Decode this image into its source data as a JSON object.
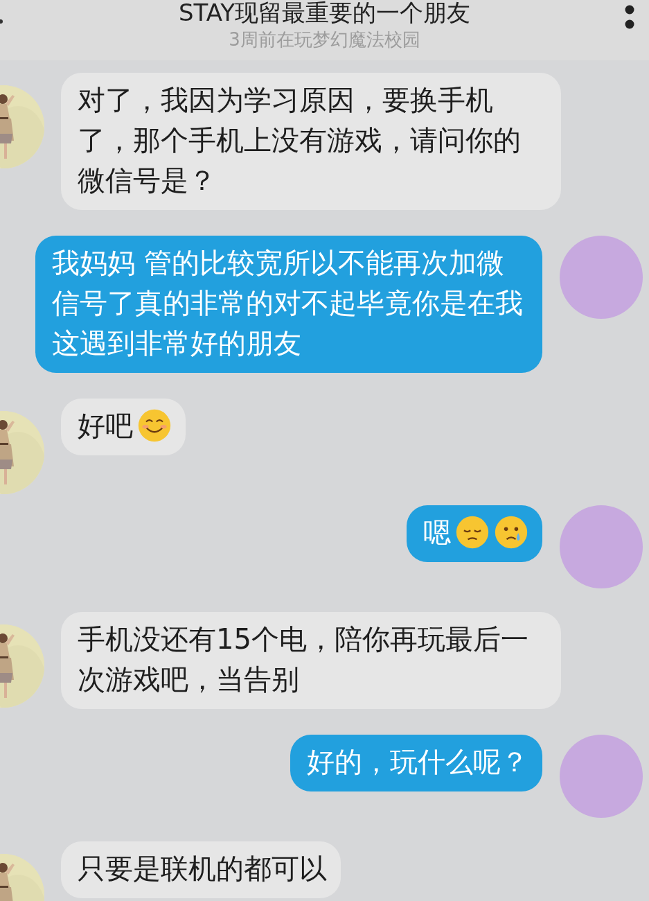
{
  "header": {
    "title": "STAY现留最重要的一个朋友",
    "subtitle": "3周前在玩梦幻魔法校园"
  },
  "messages": [
    {
      "kind": "incoming",
      "text": "对了，我因为学习原因，要换手机了，那个手机上没有游戏，请问你的微信号是？"
    },
    {
      "kind": "outgoing",
      "text": "我妈妈 管的比较宽所以不能再次加微信号了真的非常的对不起毕竟你是在我这遇到非常好的朋友"
    },
    {
      "kind": "incoming",
      "text": "好吧",
      "emojis": [
        {
          "kind": "smiling"
        }
      ]
    },
    {
      "kind": "outgoing",
      "text": "嗯",
      "emojis": [
        {
          "kind": "pensive"
        },
        {
          "kind": "crying"
        }
      ]
    },
    {
      "kind": "incoming",
      "text": "手机没还有15个电，陪你再玩最后一次游戏吧，当告别"
    },
    {
      "kind": "outgoing",
      "text": "好的，玩什么呢？"
    },
    {
      "kind": "incoming",
      "text": "只要是联机的都可以"
    }
  ]
}
